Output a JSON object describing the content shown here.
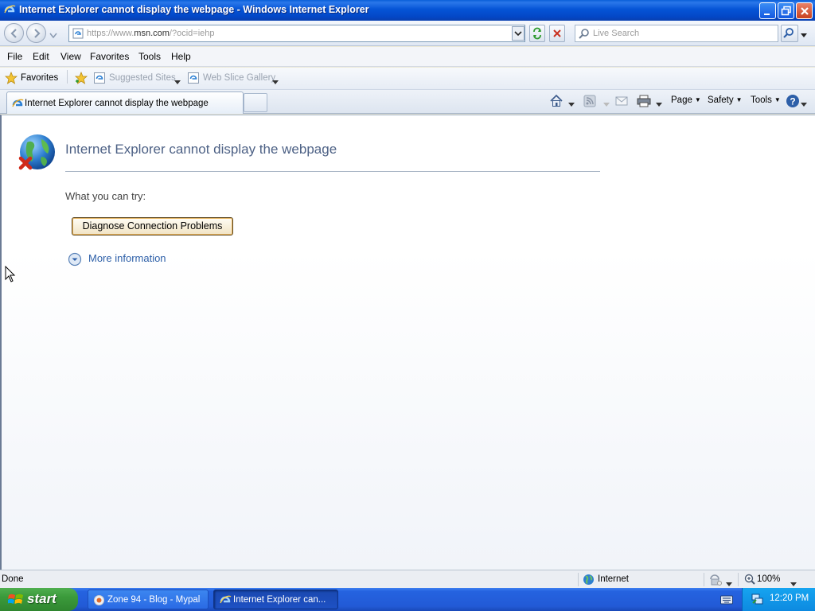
{
  "window": {
    "title": "Internet Explorer cannot display the webpage - Windows Internet Explorer"
  },
  "address_bar": {
    "url_prefix": "https://www.",
    "url_domain": "msn.com",
    "url_suffix": "/?ocid=iehp"
  },
  "search": {
    "placeholder": "Live Search"
  },
  "menu": {
    "items": [
      "File",
      "Edit",
      "View",
      "Favorites",
      "Tools",
      "Help"
    ]
  },
  "favorites_bar": {
    "favorites_label": "Favorites",
    "suggested_sites": "Suggested Sites",
    "web_slice_gallery": "Web Slice Gallery"
  },
  "tab": {
    "label": "Internet Explorer cannot display the webpage"
  },
  "command_bar": {
    "page": "Page",
    "safety": "Safety",
    "tools": "Tools"
  },
  "content": {
    "heading": "Internet Explorer cannot display the webpage",
    "what_you_can_try": "What you can try:",
    "diagnose_button": "Diagnose Connection Problems",
    "more_information": "More information"
  },
  "status_bar": {
    "status": "Done",
    "zone": "Internet",
    "zoom": "100%"
  },
  "taskbar": {
    "start_label": "start",
    "tasks": [
      "Zone 94 - Blog - Mypal",
      "Internet Explorer can..."
    ],
    "clock": "12:20 PM"
  },
  "colors": {
    "title_bar": "#0554d6",
    "link": "#2d5fa8",
    "heading": "#4d6185"
  }
}
